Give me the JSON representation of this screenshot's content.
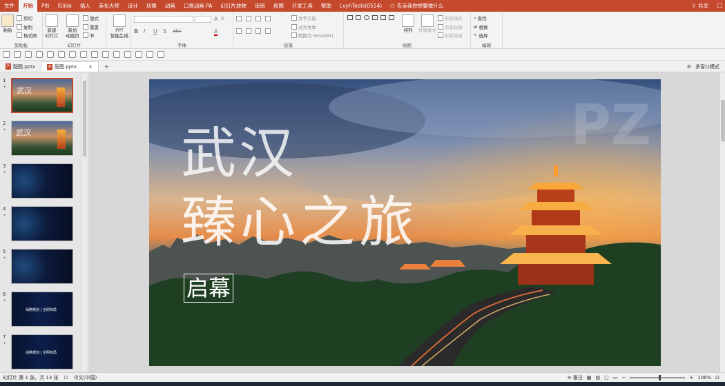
{
  "menu": {
    "tabs": [
      "文件",
      "开始",
      "Piti",
      "iSlide",
      "插入",
      "美化大师",
      "设计",
      "切换",
      "动画",
      "口袋动画 PA",
      "幻灯片放映",
      "审阅",
      "视图",
      "开发工具",
      "帮助",
      "LvyhTools(0514)"
    ],
    "active_tab": "开始",
    "tell_me": "告诉我你想要做什么",
    "share": "共享"
  },
  "ribbon": {
    "clipboard": {
      "label": "剪贴板",
      "paste": "粘贴",
      "cut": "剪切",
      "copy": "复制",
      "format_painter": "格式刷"
    },
    "slides": {
      "label": "幻灯片",
      "new_slide": "新建\n幻灯片",
      "reuse": "新加\n动画页",
      "layout": "版式",
      "reset": "重置",
      "section": "节"
    },
    "ppt": {
      "label": "PPT\n智能生成"
    },
    "font": {
      "label": "字体",
      "bold": "B",
      "italic": "I",
      "underline": "U",
      "strike": "S",
      "shadow": "abc",
      "font_color": "A"
    },
    "paragraph": {
      "label": "段落",
      "text_direction": "文字方向",
      "align_text": "对齐文本",
      "smartart": "转换为 SmartArt"
    },
    "drawing": {
      "label": "绘图",
      "arrange": "排列",
      "quick_styles": "快速样式",
      "fill": "形状填充",
      "outline": "形状轮廓",
      "effects": "形状效果"
    },
    "editing": {
      "label": "编辑",
      "find": "查找",
      "replace": "替换",
      "select": "选择"
    }
  },
  "file_tabs": [
    {
      "name": "配图.pptx",
      "active": false
    },
    {
      "name": "配图.pptx",
      "active": true
    }
  ],
  "file_tabs_right": {
    "multi_window": "多窗口模式"
  },
  "thumbnails": [
    {
      "num": "1",
      "style": "wuhan",
      "title": "武汉",
      "active": true
    },
    {
      "num": "2",
      "style": "wuhan",
      "title": "武汉",
      "active": false
    },
    {
      "num": "3",
      "style": "dark",
      "title": "",
      "active": false
    },
    {
      "num": "4",
      "style": "dark",
      "title": "",
      "active": false
    },
    {
      "num": "5",
      "style": "dark",
      "title": "",
      "active": false
    },
    {
      "num": "6",
      "style": "strip",
      "title": "",
      "caption": "战略规划 | 全网布局",
      "active": false
    },
    {
      "num": "7",
      "style": "strip",
      "title": "",
      "caption": "战略规划 | 全网布局",
      "active": false
    }
  ],
  "slide": {
    "title_line1": "武汉",
    "title_line2": "臻心之旅",
    "subtitle": "启幕",
    "watermark": "PZ"
  },
  "status": {
    "slide_count": "幻灯片 第 1 张，共 13 张",
    "language": "中文(中国)",
    "notes": "备注",
    "zoom": "106%"
  },
  "colors": {
    "accent": "#c5492d",
    "ribbon_bg": "#f3f3f3"
  }
}
